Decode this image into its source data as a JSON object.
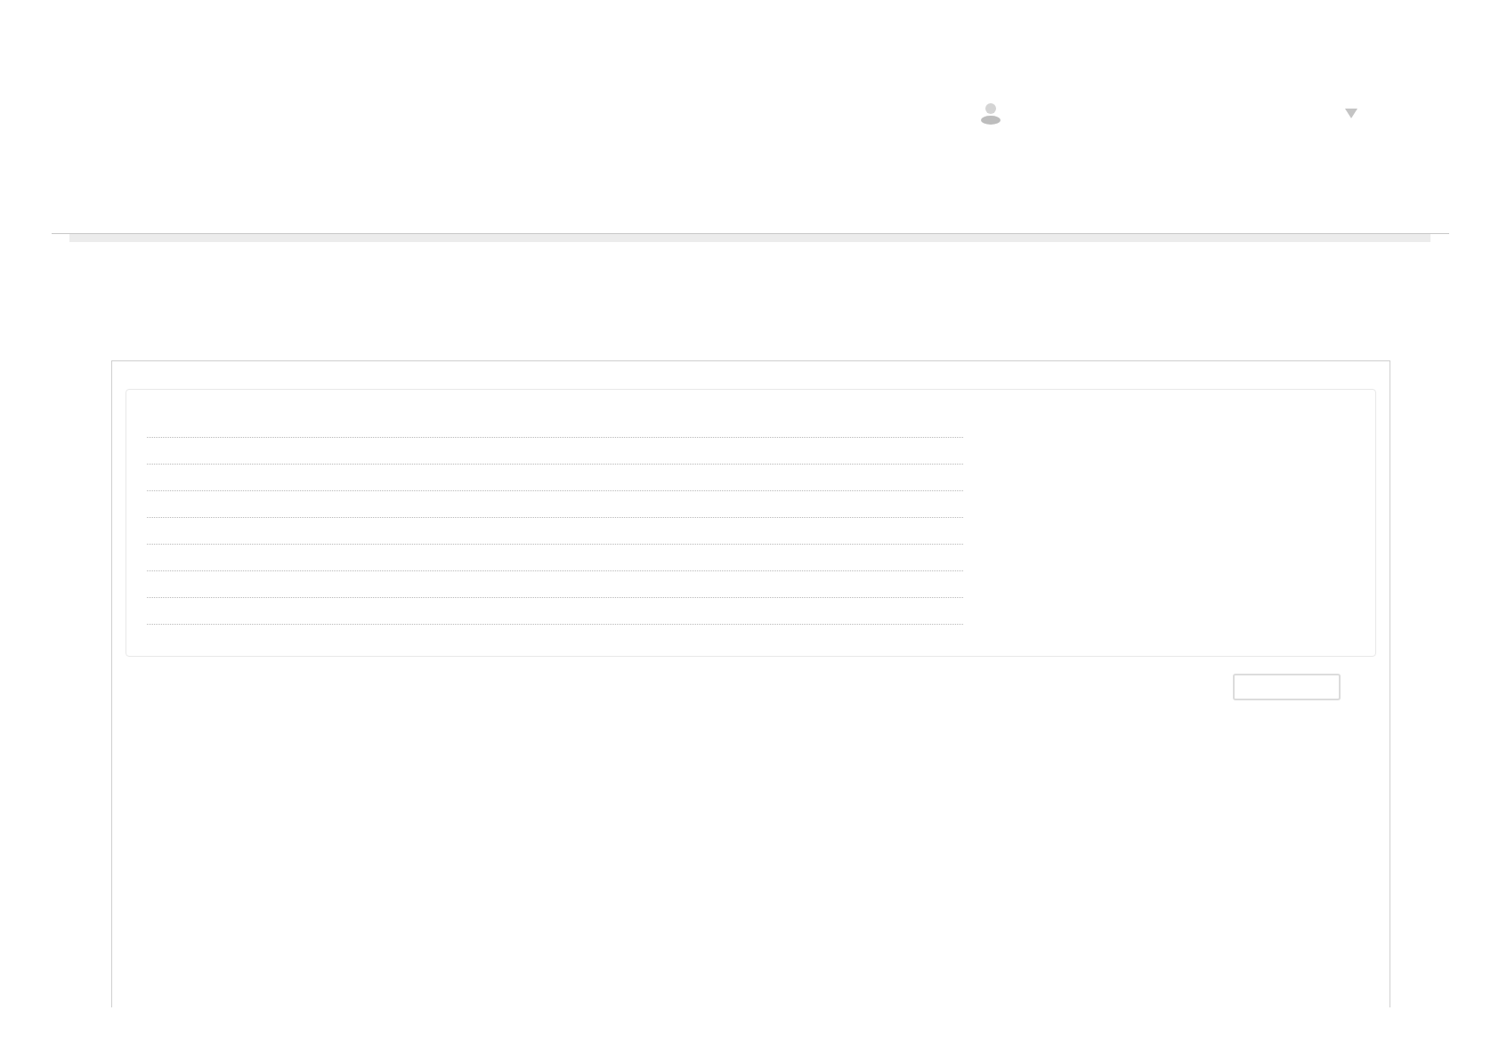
{
  "user_menu": {
    "expanded": false
  },
  "detail_rows": [
    {
      "kind": "blank"
    },
    {
      "kind": "blank"
    },
    {
      "kind": "blank"
    },
    {
      "kind": "blank"
    },
    {
      "kind": "blank"
    },
    {
      "kind": "blank"
    },
    {
      "kind": "blank"
    },
    {
      "kind": "blank"
    }
  ],
  "action_button": {
    "kind": "blank"
  }
}
